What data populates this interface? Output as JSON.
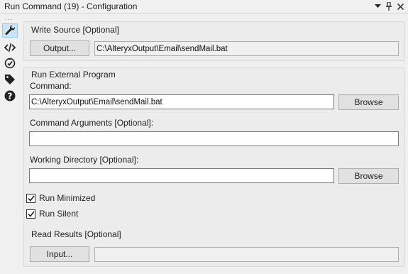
{
  "window": {
    "title": "Run Command (19) - Configuration",
    "controls": [
      "dropdown-icon",
      "pin-icon",
      "close-icon"
    ]
  },
  "toolstrip": {
    "dots": "...",
    "items": [
      {
        "icon": "wrench-icon",
        "active": true
      },
      {
        "icon": "code-icon",
        "active": false
      },
      {
        "icon": "annotation-icon",
        "active": false
      },
      {
        "icon": "tag-icon",
        "active": false
      },
      {
        "icon": "help-icon",
        "active": false
      }
    ]
  },
  "write_source": {
    "title": "Write Source [Optional]",
    "button": "Output...",
    "value": "C:\\AlteryxOutput\\Email\\sendMail.bat"
  },
  "run_external": {
    "title": "Run External Program",
    "command_label": "Command:",
    "command_value": "C:\\AlteryxOutput\\Email\\sendMail.bat",
    "browse_label": "Browse",
    "args_label": "Command Arguments [Optional]:",
    "args_value": "",
    "workdir_label": "Working Directory [Optional]:",
    "workdir_value": "",
    "browse2_label": "Browse"
  },
  "options": {
    "run_minimized_label": "Run Minimized",
    "run_minimized_checked": true,
    "run_silent_label": "Run Silent",
    "run_silent_checked": true
  },
  "read_results": {
    "title": "Read Results [Optional]",
    "button": "Input...",
    "value": ""
  }
}
